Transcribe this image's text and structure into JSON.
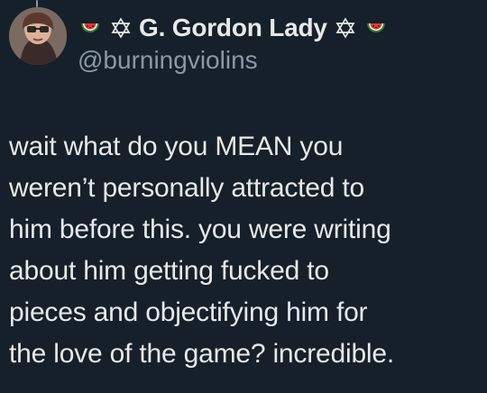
{
  "tweet": {
    "display_name": "G. Gordon Lady",
    "handle": "@burningviolins",
    "text": "wait what do you MEAN you\nweren’t personally attracted to\nhim before this. you were writing\nabout him getting fucked to\npieces and objectifying him for\nthe love of the game? incredible.",
    "name_decorations": [
      "watermelon-icon",
      "star-of-david-icon",
      "star-of-david-icon",
      "watermelon-icon"
    ]
  },
  "colors": {
    "background": "#15202b",
    "text_primary": "#e7e9ea",
    "text_secondary": "#8b98a5"
  }
}
